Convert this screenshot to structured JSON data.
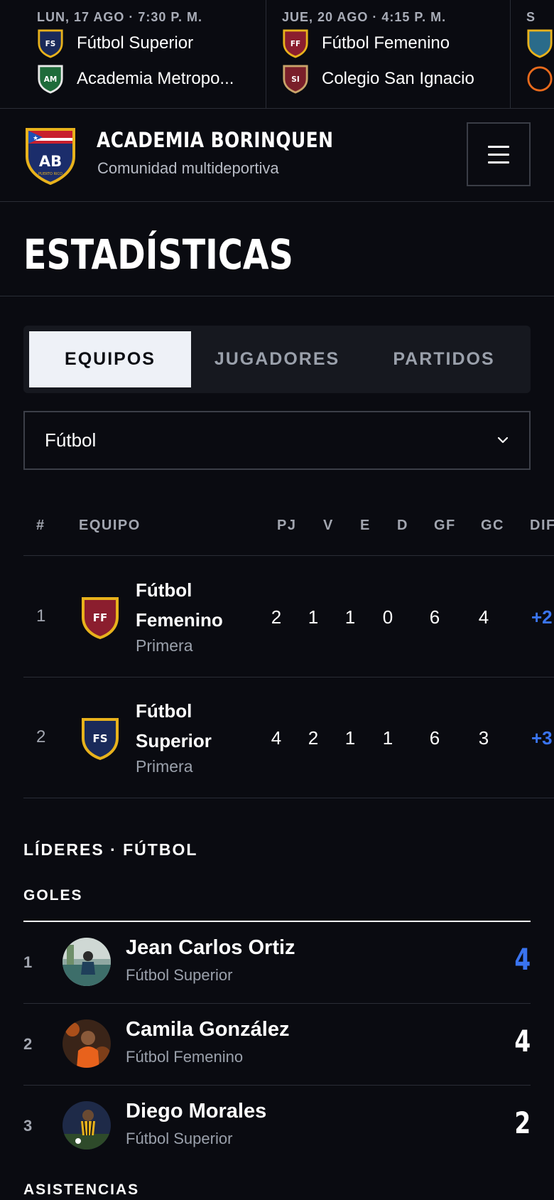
{
  "ticker": {
    "games": [
      {
        "date": "LUN, 17 AGO · 7:30 P. M.",
        "home": {
          "abbr": "FS",
          "name": "Fútbol Superior"
        },
        "away": {
          "abbr": "AM",
          "name": "Academia Metropo..."
        }
      },
      {
        "date": "JUE, 20 AGO · 4:15 P. M.",
        "home": {
          "abbr": "FF",
          "name": "Fútbol Femenino"
        },
        "away": {
          "abbr": "SI",
          "name": "Colegio San Ignacio"
        }
      },
      {
        "date": "S",
        "home": {
          "abbr": "",
          "name": ""
        },
        "away": {
          "abbr": "",
          "name": ""
        }
      }
    ]
  },
  "header": {
    "logo_text": "AB",
    "logo_sub": "PUERTO RICO",
    "brand_name": "ACADEMIA BORINQUEN",
    "brand_sub": "Comunidad multideportiva"
  },
  "page": {
    "title": "ESTADÍSTICAS"
  },
  "tabs": [
    {
      "label": "EQUIPOS",
      "active": true
    },
    {
      "label": "JUGADORES",
      "active": false
    },
    {
      "label": "PARTIDOS",
      "active": false
    }
  ],
  "sport_select": {
    "value": "Fútbol"
  },
  "standings": {
    "headers": {
      "rank": "#",
      "team": "EQUIPO",
      "pj": "PJ",
      "v": "V",
      "e": "E",
      "d": "D",
      "gf": "GF",
      "gc": "GC",
      "dif": "DIF"
    },
    "rows": [
      {
        "rank": "1",
        "abbr": "FF",
        "name": "Fútbol Femenino",
        "division": "Primera",
        "pj": "2",
        "v": "1",
        "e": "1",
        "d": "0",
        "gf": "6",
        "gc": "4",
        "dif": "+2"
      },
      {
        "rank": "2",
        "abbr": "FS",
        "name": "Fútbol Superior",
        "division": "Primera",
        "pj": "4",
        "v": "2",
        "e": "1",
        "d": "1",
        "gf": "6",
        "gc": "3",
        "dif": "+3"
      }
    ]
  },
  "leaders": {
    "title": "LÍDERES · FÚTBOL",
    "goals_title": "GOLES",
    "goals": [
      {
        "rank": "1",
        "name": "Jean Carlos Ortiz",
        "team": "Fútbol Superior",
        "value": "4"
      },
      {
        "rank": "2",
        "name": "Camila González",
        "team": "Fútbol Femenino",
        "value": "4"
      },
      {
        "rank": "3",
        "name": "Diego Morales",
        "team": "Fútbol Superior",
        "value": "2"
      }
    ],
    "assists_title": "ASISTENCIAS"
  },
  "colors": {
    "background": "#0a0b11",
    "accent_blue": "#3a74f0",
    "crest_ff": "#8b1e2e",
    "crest_fs": "#1a2a5a",
    "crest_am": "#1e6b3a",
    "crest_gold": "#e8b21c"
  }
}
